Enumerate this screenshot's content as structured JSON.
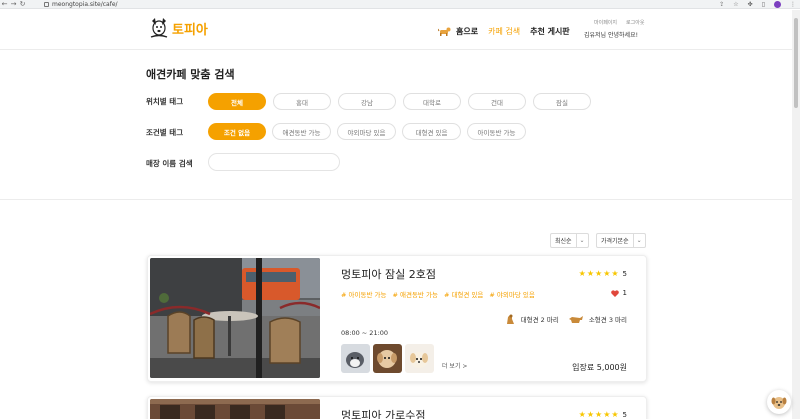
{
  "browser": {
    "url": "meongtopia.site/cafe/"
  },
  "header": {
    "logo_text": "토피아",
    "nav": {
      "home": "홈으로",
      "cafe_search": "카페 검색",
      "recommend": "추천 게시판"
    },
    "user_links": [
      "마이페이지",
      "로그아웃"
    ],
    "greeting": "김유저님 안녕하세요!"
  },
  "search": {
    "title": "애견카페 맞춤 검색",
    "location_label": "위치별 태그",
    "location_tags": [
      "전체",
      "홍대",
      "강남",
      "대학로",
      "건대",
      "잠실"
    ],
    "location_selected": "전체",
    "condition_label": "조건별 태그",
    "condition_tags": [
      "조건 없음",
      "애견동반 가능",
      "야외마당 있음",
      "대형견 있음",
      "아이동반 가능"
    ],
    "condition_selected": "조건 없음",
    "name_label": "매장 이름 검색",
    "name_value": "",
    "name_placeholder": ""
  },
  "sort": {
    "order": "최신순",
    "price": "가격기본순"
  },
  "cafes": [
    {
      "name": "멍토피아 잠실 2호점",
      "rating": "5",
      "tags": [
        "# 아이동반 가능",
        "# 애견동반 가능",
        "# 대형견 있음",
        "# 야외마당 있음"
      ],
      "likes": "1",
      "large_dogs": "대형견 2 마리",
      "small_dogs": "소형견 3 마리",
      "hours": "08:00 ~ 21:00",
      "more": "더 보기 >",
      "fee": "입장료 5,000원"
    },
    {
      "name": "멍토피아 가로수점",
      "rating": "5"
    }
  ],
  "colors": {
    "accent": "#f5a100",
    "star": "#f7c600",
    "heart": "#e0473c"
  }
}
